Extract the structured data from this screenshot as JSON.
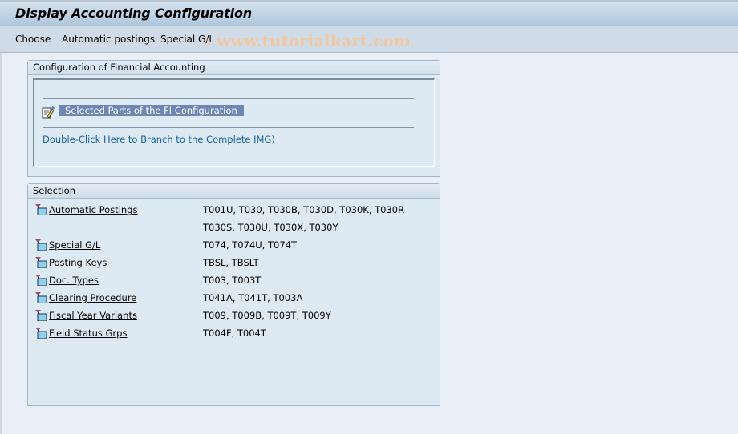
{
  "window": {
    "title": "Display Accounting Configuration"
  },
  "menubar": {
    "items": [
      "Choose",
      "Automatic postings",
      "Special G/L"
    ]
  },
  "watermark": {
    "symbol": "©",
    "text": "www.tutorialkart.com"
  },
  "config_panel": {
    "header": "Configuration of Financial Accounting",
    "selected_parts_icon": "edit-document-icon",
    "selected_parts_label": "Selected Parts of the FI Configuration",
    "img_link": "Double-Click Here to Branch to the Complete IMG)"
  },
  "selection_panel": {
    "header": "Selection",
    "item_icon": "folder-tree-icon",
    "rows": [
      {
        "label": "Automatic Postings",
        "tables": "T001U, T030,  T030B, T030D, T030K, T030R"
      },
      {
        "label": "",
        "tables": "T030S, T030U, T030X, T030Y"
      },
      {
        "label": "Special G/L",
        "tables": "T074,  T074U, T074T"
      },
      {
        "label": "Posting Keys",
        "tables": "TBSL,  TBSLT"
      },
      {
        "label": "Doc. Types",
        "tables": "T003,  T003T"
      },
      {
        "label": "Clearing Procedure",
        "tables": "T041A, T041T, T003A"
      },
      {
        "label": "Fiscal Year Variants",
        "tables": "T009,  T009B, T009T, T009Y"
      },
      {
        "label": "Field Status Grps",
        "tables": "T004F, T004T"
      }
    ]
  }
}
